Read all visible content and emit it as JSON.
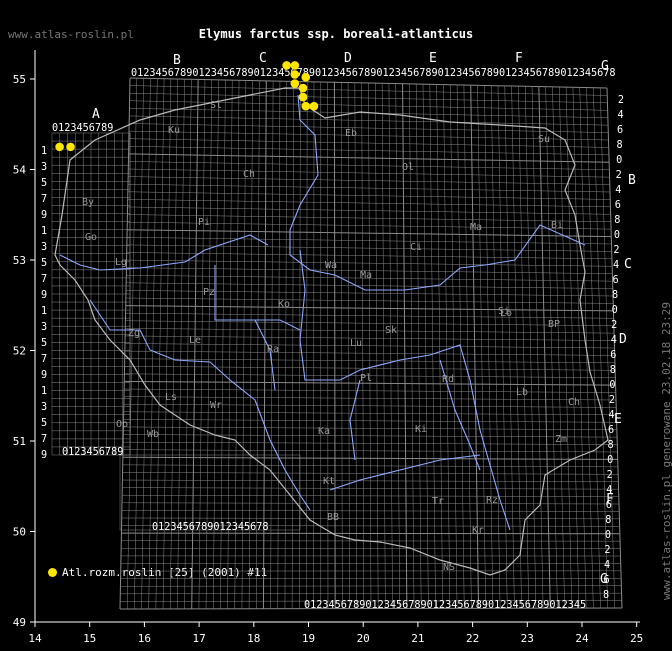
{
  "site_label": "www.atlas-roslin.pl",
  "title": "Elymus farctus ssp. boreali-atlanticus",
  "vertical_credit": "www.atlas-roslin.pl generowane 23.02.18 23:29",
  "legend": {
    "label": "Atl.rozm.roslin [25] (2001) #11",
    "color": "#ffe600"
  },
  "axes": {
    "x_ticks": [
      "14",
      "15",
      "16",
      "17",
      "18",
      "19",
      "20",
      "21",
      "22",
      "23",
      "24",
      "25"
    ],
    "y_ticks": [
      "49",
      "50",
      "51",
      "52",
      "53",
      "54",
      "55"
    ]
  },
  "grid_letters_top": [
    "A",
    "B",
    "C",
    "D",
    "E",
    "F",
    "G"
  ],
  "grid_letters_right": [
    "A",
    "B",
    "C",
    "D",
    "E",
    "F",
    "G"
  ],
  "top_digits": "0123456789012345678901234567890123456789012345678901234567890123456789012345678",
  "top_digits_a": "0123456789",
  "bottom_digits": "0123456789012345678901234567890123456789012345",
  "bottom_digits_left": "0123456789012345678",
  "left_digits": [
    "1",
    "3",
    "5",
    "7",
    "9",
    "1",
    "3",
    "5",
    "7",
    "9",
    "1",
    "3",
    "5",
    "7",
    "9",
    "1",
    "3",
    "5",
    "7",
    "9"
  ],
  "right_digits": [
    "2",
    "4",
    "6",
    "8",
    "0",
    "2",
    "4",
    "6",
    "8",
    "0",
    "2",
    "4",
    "6",
    "8",
    "0",
    "2",
    "4",
    "6",
    "8",
    "0",
    "2",
    "4",
    "6",
    "8",
    "0",
    "2",
    "4",
    "6",
    "8",
    "0",
    "2",
    "4",
    "6",
    "8"
  ],
  "region_codes": [
    "Sl",
    "Ku",
    "Eb",
    "Ol",
    "Su",
    "Ch",
    "Pi",
    "Ko",
    "Wa",
    "Ci",
    "Bi",
    "Ma",
    "Lo",
    "Sk",
    "Ra",
    "Si",
    "BP",
    "Zg",
    "Le",
    "Lu",
    "Pl",
    "Rd",
    "Lb",
    "Ch",
    "Wr",
    "Ki",
    "Wb",
    "Op",
    "Zm",
    "Kt",
    "Tr",
    "Rz",
    "BB",
    "NS",
    "Kr",
    "Ls",
    "Go",
    "Pz",
    "By",
    "Ka",
    "Ma",
    "Lg"
  ],
  "region_colors": {
    "grid": "#8a8a8a",
    "border": "#bbbbbb",
    "river": "#8fa8ff",
    "labels": "#9a9a9a"
  },
  "occurrences": [
    {
      "lon": 14.45,
      "lat": 54.25
    },
    {
      "lon": 14.65,
      "lat": 54.25
    },
    {
      "lon": 18.6,
      "lat": 55.15
    },
    {
      "lon": 18.75,
      "lat": 55.15
    },
    {
      "lon": 18.75,
      "lat": 55.05
    },
    {
      "lon": 18.95,
      "lat": 55.02
    },
    {
      "lon": 18.75,
      "lat": 54.95
    },
    {
      "lon": 18.9,
      "lat": 54.9
    },
    {
      "lon": 18.9,
      "lat": 54.8
    },
    {
      "lon": 18.95,
      "lat": 54.7
    },
    {
      "lon": 19.1,
      "lat": 54.7
    }
  ]
}
